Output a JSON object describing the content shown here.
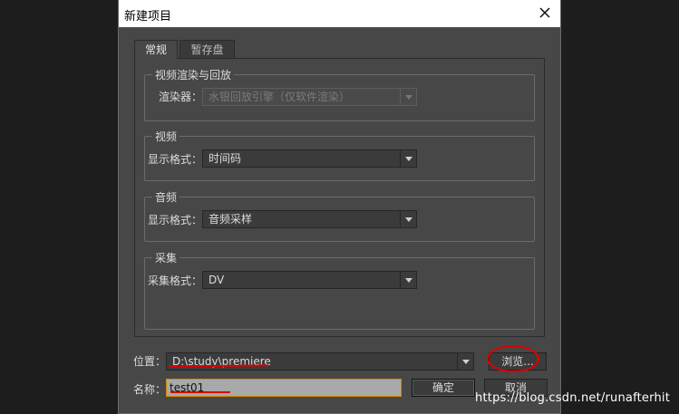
{
  "window": {
    "title": "新建项目"
  },
  "tabs": [
    {
      "label": "常规"
    },
    {
      "label": "暂存盘"
    }
  ],
  "groups": {
    "render": {
      "title": "视频渲染与回放",
      "field_label": "渲染器：",
      "value": "水银回放引擎（仅软件渲染）"
    },
    "video": {
      "title": "视频",
      "field_label": "显示格式：",
      "value": "时间码"
    },
    "audio": {
      "title": "音频",
      "field_label": "显示格式：",
      "value": "音频采样"
    },
    "capture": {
      "title": "采集",
      "field_label": "采集格式：",
      "value": "DV"
    }
  },
  "location": {
    "label": "位置：",
    "value": "D:\\study\\premiere",
    "browse_label": "浏览..."
  },
  "name": {
    "label": "名称：",
    "value": "test01"
  },
  "buttons": {
    "ok": "确定",
    "cancel": "取消"
  },
  "watermark": "https://blog.csdn.net/runafterhit",
  "colors": {
    "dialog_bg": "#474747",
    "annotation_red": "#e00000",
    "name_field_border": "#d08a00"
  }
}
